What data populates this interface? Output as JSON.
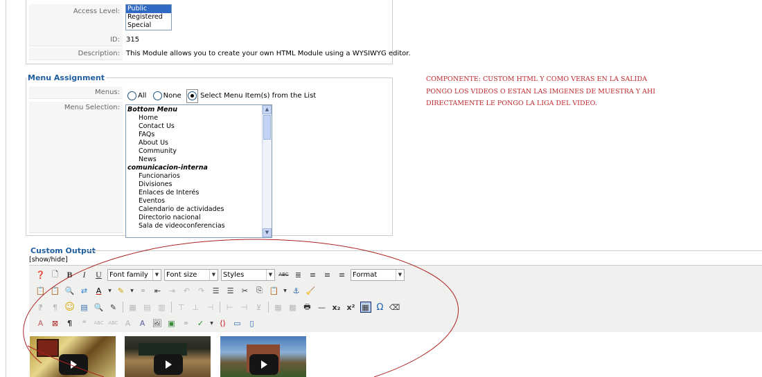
{
  "details": {
    "access_level_label": "Access Level:",
    "access_options": [
      "Public",
      "Registered",
      "Special"
    ],
    "access_selected_index": 0,
    "id_label": "ID:",
    "id_value": "315",
    "description_label": "Description:",
    "description_value": "This Module allows you to create your own HTML Module using a WYSIWYG editor."
  },
  "menu_assignment": {
    "legend": "Menu Assignment",
    "menus_label": "Menus:",
    "radio_all": "All",
    "radio_none": "None",
    "radio_select": "Select Menu Item(s) from the List",
    "selected_radio": "select",
    "selection_label": "Menu Selection:",
    "groups": [
      {
        "name": "Bottom Menu",
        "items": [
          "Home",
          "Contact Us",
          "FAQs",
          "About Us",
          "Community",
          "News"
        ]
      },
      {
        "name": "comunicacion-interna",
        "items": [
          "Funcionarios",
          "Divisiones",
          "Enlaces de Interés",
          "Eventos",
          "Calendario de actividades",
          "Directorio nacional",
          "Sala de videoconferencias"
        ]
      }
    ]
  },
  "custom_output": {
    "legend": "Custom Output",
    "toggle": "[show/hide]",
    "font_family": "Font family",
    "font_size": "Font size",
    "styles": "Styles",
    "format": "Format"
  },
  "annotation": {
    "lines": [
      "COMPONENTE: CUSTOM HTML Y COMO VERAS EN LA SALIDA",
      "PONGO LOS VIDEOS O ESTAN LAS IMGENES DE MUESTRA Y AHI",
      "DIRECTAMENTE LE PONGO LA LIGA DEL VIDEO."
    ],
    "color": "#c0282d"
  },
  "colors": {
    "legend": "#1f5d9f",
    "selection": "#316ac5",
    "annotation_ellipse": "#b02020"
  },
  "videos": [
    {
      "icon": "play-icon"
    },
    {
      "icon": "play-icon"
    },
    {
      "icon": "play-icon"
    }
  ]
}
